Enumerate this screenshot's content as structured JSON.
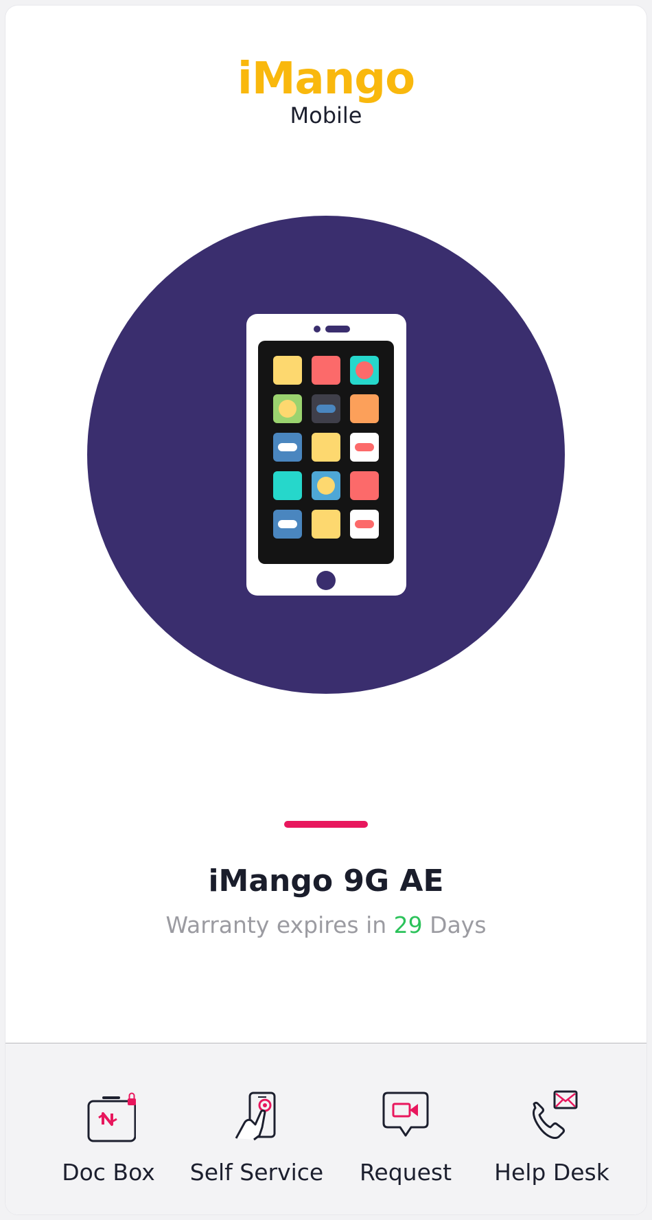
{
  "brand": {
    "name": "iMango",
    "subtitle": "Mobile"
  },
  "device": {
    "name": "iMango 9G AE",
    "warranty_prefix": "Warranty expires in",
    "warranty_days": "29",
    "warranty_suffix": "Days"
  },
  "nav": {
    "items": [
      {
        "label": "Doc Box",
        "icon": "doc-box-icon"
      },
      {
        "label": "Self Service",
        "icon": "self-service-icon"
      },
      {
        "label": "Request",
        "icon": "video-request-icon"
      },
      {
        "label": "Help Desk",
        "icon": "help-desk-icon"
      }
    ]
  },
  "colors": {
    "brand": "#f9b80d",
    "hero_circle": "#3a2e6e",
    "accent": "#e8175d",
    "days_highlight": "#2bc25a"
  }
}
